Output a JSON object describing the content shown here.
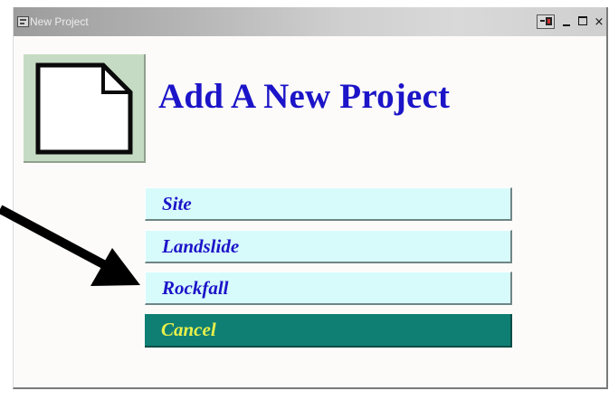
{
  "window": {
    "title": "New Project"
  },
  "titlebar_buttons": {
    "close_glyph": "×"
  },
  "heading": "Add A New Project",
  "menu": {
    "options": [
      "Site",
      "Landslide",
      "Rockfall"
    ],
    "cancel_label": "Cancel"
  },
  "colors": {
    "heading": "#1c14c8",
    "option_background": "#d7fbfb",
    "cancel_background": "#0f7f74",
    "cancel_text": "#e8f04a",
    "icon_tile": "#c6dbc3"
  },
  "icons": {
    "app_icon": "new-document-icon",
    "annotation": "pointer-arrow"
  }
}
